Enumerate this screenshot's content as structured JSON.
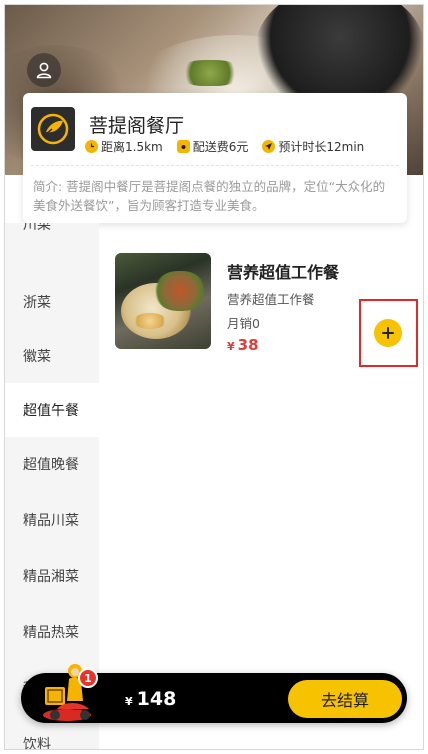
{
  "store": {
    "name": "菩提阁餐厅",
    "distance": "距离1.5km",
    "delivery_fee": "配送费6元",
    "eta": "预计时长12min",
    "intro": "简介: 菩提阁中餐厅是菩提阁点餐的独立的品牌，定位“大众化的美食外送餐饮”，旨为顾客打造专业美食。"
  },
  "categories": [
    {
      "label": "川菜"
    },
    {
      "label": "浙菜"
    },
    {
      "label": "徽菜"
    },
    {
      "label": "超值午餐",
      "active": true
    },
    {
      "label": "超值晚餐"
    },
    {
      "label": "精品川菜"
    },
    {
      "label": "精品湘菜"
    },
    {
      "label": "精品热菜"
    },
    {
      "label": "甜点"
    },
    {
      "label": "饮料"
    }
  ],
  "products": [
    {
      "name": "营养超值工作餐",
      "description": "营养超值工作餐",
      "sales": "月销0",
      "currency": "¥",
      "price": "38"
    }
  ],
  "cart": {
    "count": "1",
    "currency": "¥",
    "total": "148",
    "checkout_label": "去结算"
  },
  "colors": {
    "accent": "#f7c200",
    "price": "#e23b3b",
    "badge": "#e8332b",
    "highlight": "#e02a2a"
  }
}
